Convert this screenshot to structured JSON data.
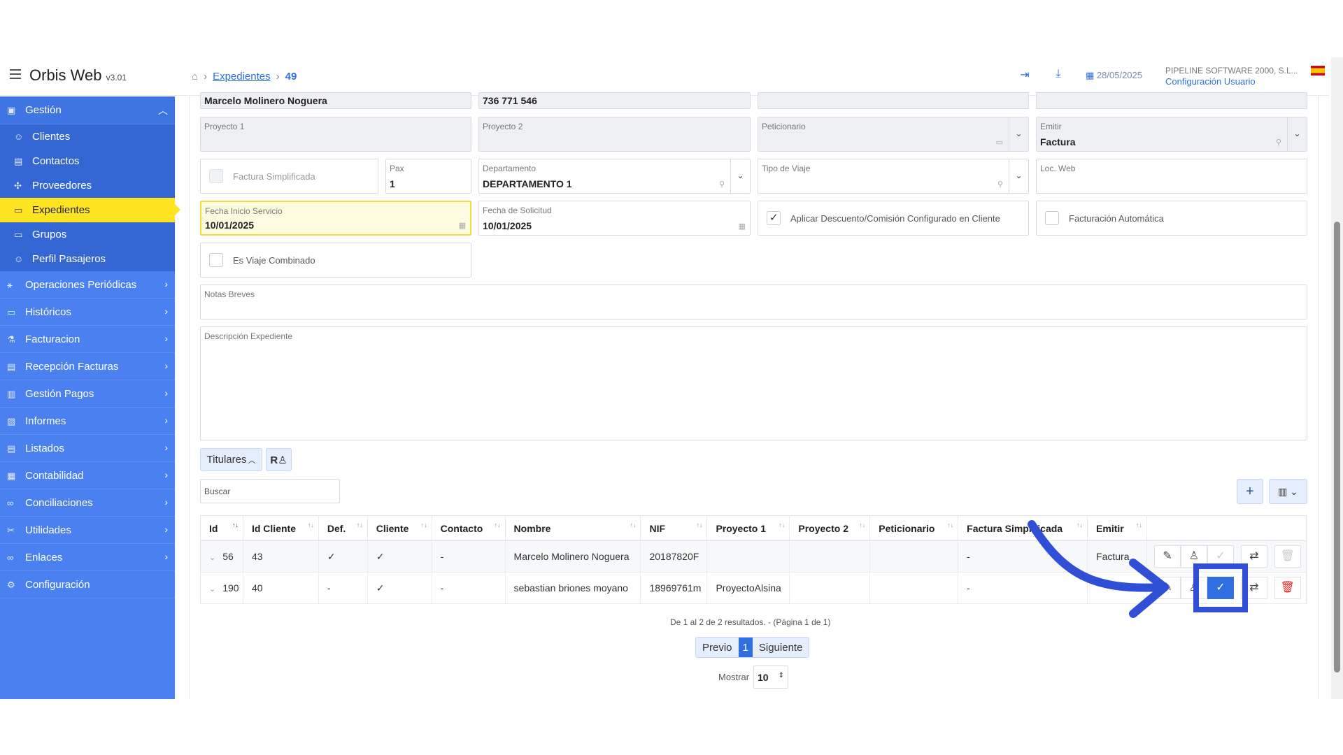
{
  "header": {
    "brand": "Orbis Web",
    "version": "v3.01",
    "breadcrumb_link": "Expedientes",
    "breadcrumb_current": "49",
    "date": "28/05/2025",
    "company": "PIPELINE SOFTWARE 2000, S.L...",
    "user_config": "Configuración Usuario"
  },
  "sidebar": {
    "groups": [
      {
        "label": "Gestión"
      },
      {
        "label": "Operaciones Periódicas"
      },
      {
        "label": "Históricos"
      },
      {
        "label": "Facturacion"
      },
      {
        "label": "Recepción Facturas"
      },
      {
        "label": "Gestión Pagos"
      },
      {
        "label": "Informes"
      },
      {
        "label": "Listados"
      },
      {
        "label": "Contabilidad"
      },
      {
        "label": "Conciliaciones"
      },
      {
        "label": "Utilidades"
      },
      {
        "label": "Enlaces"
      },
      {
        "label": "Configuración"
      }
    ],
    "items": [
      {
        "label": "Clientes"
      },
      {
        "label": "Contactos"
      },
      {
        "label": "Proveedores"
      },
      {
        "label": "Expedientes"
      },
      {
        "label": "Grupos"
      },
      {
        "label": "Perfil Pasajeros"
      }
    ]
  },
  "form": {
    "name_value": "Marcelo Molinero Noguera",
    "phone_value": "736 771 546",
    "proyecto1_label": "Proyecto 1",
    "proyecto2_label": "Proyecto 2",
    "peticionario_label": "Peticionario",
    "emitir_label": "Emitir",
    "emitir_value": "Factura",
    "factura_simplificada_label": "Factura Simplificada",
    "pax_label": "Pax",
    "pax_value": "1",
    "departamento_label": "Departamento",
    "departamento_value": "DEPARTAMENTO 1",
    "tipo_viaje_label": "Tipo de Viaje",
    "loc_web_label": "Loc. Web",
    "fecha_inicio_label": "Fecha Inicio Servicio",
    "fecha_inicio_value": "10/01/2025",
    "fecha_solicitud_label": "Fecha de Solicitud",
    "fecha_solicitud_value": "10/01/2025",
    "aplicar_descuento_label": "Aplicar Descuento/Comisión Configurado en Cliente",
    "facturacion_auto_label": "Facturación Automática",
    "viaje_combinado_label": "Es Viaje Combinado",
    "notas_label": "Notas Breves",
    "descripcion_label": "Descripción Expediente"
  },
  "titulares": {
    "tab_label": "Titulares",
    "search_placeholder": "Buscar",
    "columns": [
      "Id",
      "Id Cliente",
      "Def.",
      "Cliente",
      "Contacto",
      "Nombre",
      "NIF",
      "Proyecto 1",
      "Proyecto 2",
      "Peticionario",
      "Factura Simplificada",
      "Emitir"
    ],
    "rows": [
      {
        "id": "56",
        "id_cliente": "43",
        "def": "✓",
        "cliente": "✓",
        "contacto": "-",
        "nombre": "Marcelo Molinero Noguera",
        "nif": "20187820F",
        "proyecto1": "",
        "proyecto2": "",
        "peticionario": "",
        "factura_simplificada": "-",
        "emitir": "Factura"
      },
      {
        "id": "190",
        "id_cliente": "40",
        "def": "-",
        "cliente": "✓",
        "contacto": "-",
        "nombre": "sebastian briones moyano",
        "nif": "18969761m",
        "proyecto1": "ProyectoAlsina",
        "proyecto2": "",
        "peticionario": "",
        "factura_simplificada": "-",
        "emitir": ""
      }
    ],
    "results_text": "De 1 al 2 de 2 resultados. - (Página 1 de 1)",
    "prev_label": "Previo",
    "current_page": "1",
    "next_label": "Siguiente",
    "show_label": "Mostrar",
    "page_size": "10"
  },
  "colors": {
    "sidebar": "#4a80ef",
    "active": "#ffe521",
    "primary": "#2f6fe0",
    "annotation": "#2f4fd6"
  }
}
